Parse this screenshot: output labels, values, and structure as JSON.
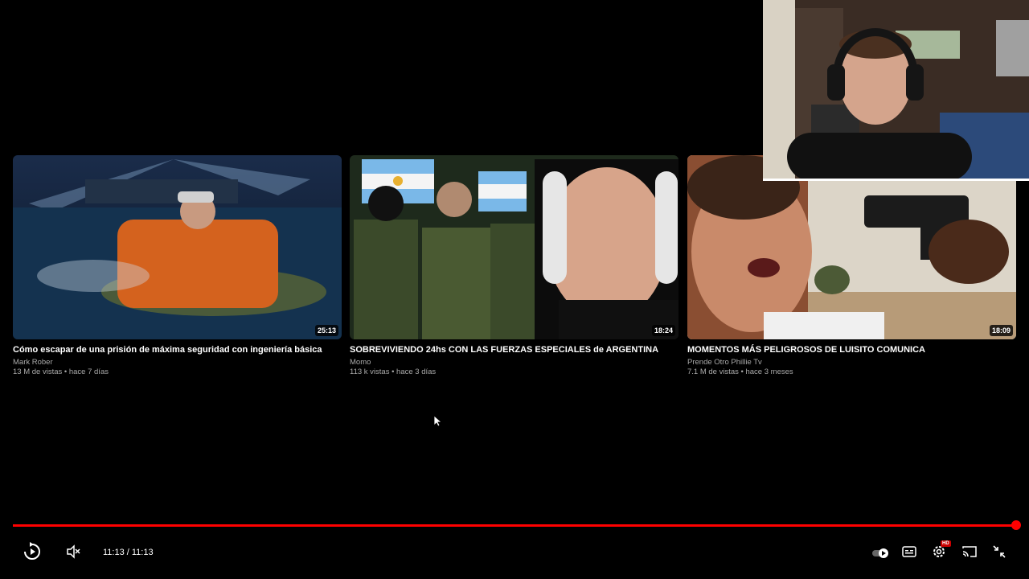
{
  "videos": [
    {
      "title": "Cómo escapar de una prisión de máxima seguridad con ingeniería básica",
      "channel": "Mark Rober",
      "meta": "13 M de vistas • hace 7 días",
      "duration": "25:13"
    },
    {
      "title": "SOBREVIVIENDO 24hs CON LAS FUERZAS ESPECIALES de ARGENTINA",
      "channel": "Momo",
      "meta": "113 k vistas • hace 3 días",
      "duration": "18:24"
    },
    {
      "title": "MOMENTOS MÁS PELIGROSOS DE LUISITO COMUNICA",
      "channel": "Prende Otro Phillie Tv",
      "meta": "7.1 M de vistas • hace 3 meses",
      "duration": "18:09"
    }
  ],
  "player": {
    "time": "11:13 / 11:13",
    "progress_fraction": 1.0,
    "hd_badge": "HD",
    "accent_color": "#ff0000",
    "icons": [
      "replay-icon",
      "mute-icon",
      "autoplay-toggle",
      "subtitles-icon",
      "settings-icon",
      "cast-icon",
      "exit-fullscreen-icon"
    ]
  }
}
